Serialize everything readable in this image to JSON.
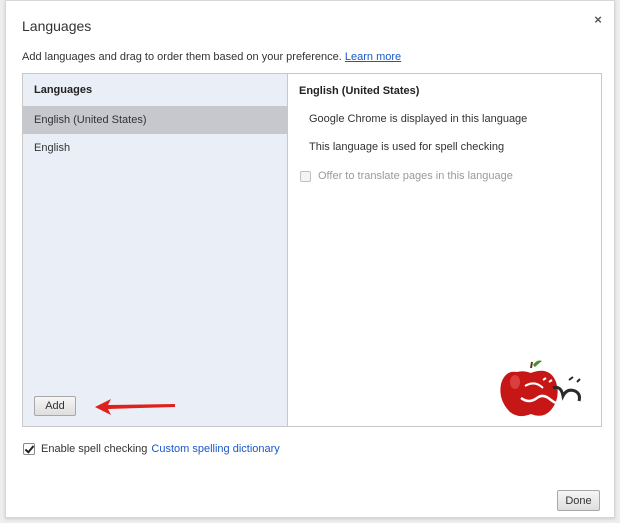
{
  "dialog": {
    "title": "Languages",
    "close_symbol": "×",
    "description": "Add languages and drag to order them based on your preference.",
    "learn_more": "Learn more"
  },
  "left_panel": {
    "header": "Languages",
    "items": [
      {
        "label": "English (United States)",
        "selected": true
      },
      {
        "label": "English",
        "selected": false
      }
    ],
    "add_label": "Add"
  },
  "right_panel": {
    "header": "English (United States)",
    "display_info": "Google Chrome is displayed in this language",
    "spell_info": "This language is used for spell checking",
    "translate_label": "Offer to translate pages in this language",
    "translate_checked": false
  },
  "footer": {
    "spell_label": "Enable spell checking",
    "spell_checked": true,
    "custom_dict": "Custom spelling dictionary",
    "done_label": "Done"
  },
  "annotation": {
    "arrow_color": "#e0201b",
    "watermark_icon": "red-apple-logo"
  }
}
